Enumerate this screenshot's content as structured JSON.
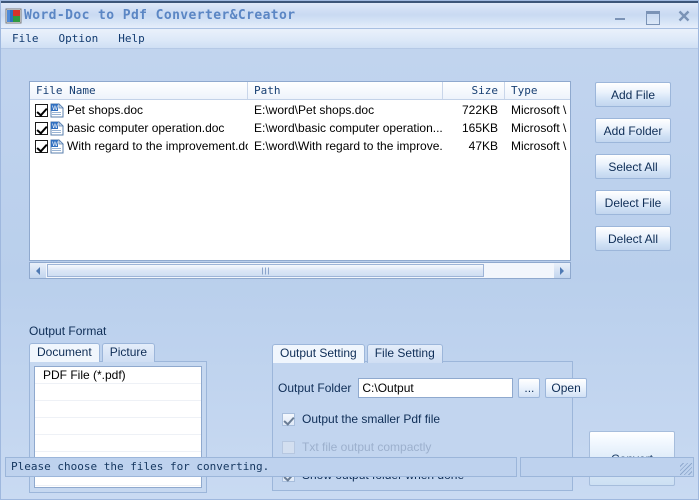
{
  "window": {
    "title": "Word-Doc to Pdf Converter&Creator",
    "app_icon": "word-pdf-app-icon",
    "minimize_label": "minimize-icon",
    "maximize_label": "maximize-icon",
    "close_label": "close-icon"
  },
  "menu": {
    "items": [
      {
        "label": "File"
      },
      {
        "label": "Option"
      },
      {
        "label": "Help"
      }
    ]
  },
  "file_list": {
    "columns": [
      "File Name",
      "Path",
      "Size",
      "Type"
    ],
    "rows": [
      {
        "checked": true,
        "name": "Pet shops.doc",
        "path": "E:\\word\\Pet shops.doc",
        "size": "722KB",
        "type": "Microsoft \\"
      },
      {
        "checked": true,
        "name": "basic computer operation.doc",
        "path": "E:\\word\\basic computer operation....",
        "size": "165KB",
        "type": "Microsoft \\"
      },
      {
        "checked": true,
        "name": "With regard to the improvement.doc",
        "path": "E:\\word\\With regard to the improve...",
        "size": "47KB",
        "type": "Microsoft \\"
      }
    ],
    "scroll_left_icon": "scroll-left-arrow-icon",
    "scroll_right_icon": "scroll-right-arrow-icon"
  },
  "side_buttons": [
    {
      "label": "Add File"
    },
    {
      "label": "Add Folder"
    },
    {
      "label": "Select All"
    },
    {
      "label": "Delect File"
    },
    {
      "label": "Delect All"
    }
  ],
  "output_format": {
    "group_label": "Output Format",
    "tabs": [
      {
        "label": "Document",
        "active": true
      },
      {
        "label": "Picture",
        "active": false
      }
    ],
    "formats": [
      "PDF File  (*.pdf)",
      "",
      "",
      "",
      "",
      "",
      ""
    ]
  },
  "output_setting": {
    "tabs": [
      {
        "label": "Output Setting",
        "active": true
      },
      {
        "label": "File Setting",
        "active": false
      }
    ],
    "output_folder_label": "Output Folder",
    "output_folder_value": "C:\\Output",
    "browse_button": "...",
    "open_button": "Open",
    "checkboxes": [
      {
        "label": "Output the smaller Pdf file",
        "checked": true,
        "disabled": false
      },
      {
        "label": "Txt file output compactly",
        "checked": false,
        "disabled": true
      },
      {
        "label": "Show output folder when done",
        "checked": true,
        "disabled": false
      }
    ]
  },
  "convert": {
    "label": "Convert"
  },
  "status_bar": {
    "message": "Please choose the files for converting.",
    "extra": "",
    "grip_icon": "resize-grip-icon"
  },
  "colors": {
    "window_bg": "#b9cfec",
    "title_text": "#5b86c4",
    "accent_text": "#0e2d56",
    "panel_border": "#9cb6da"
  }
}
